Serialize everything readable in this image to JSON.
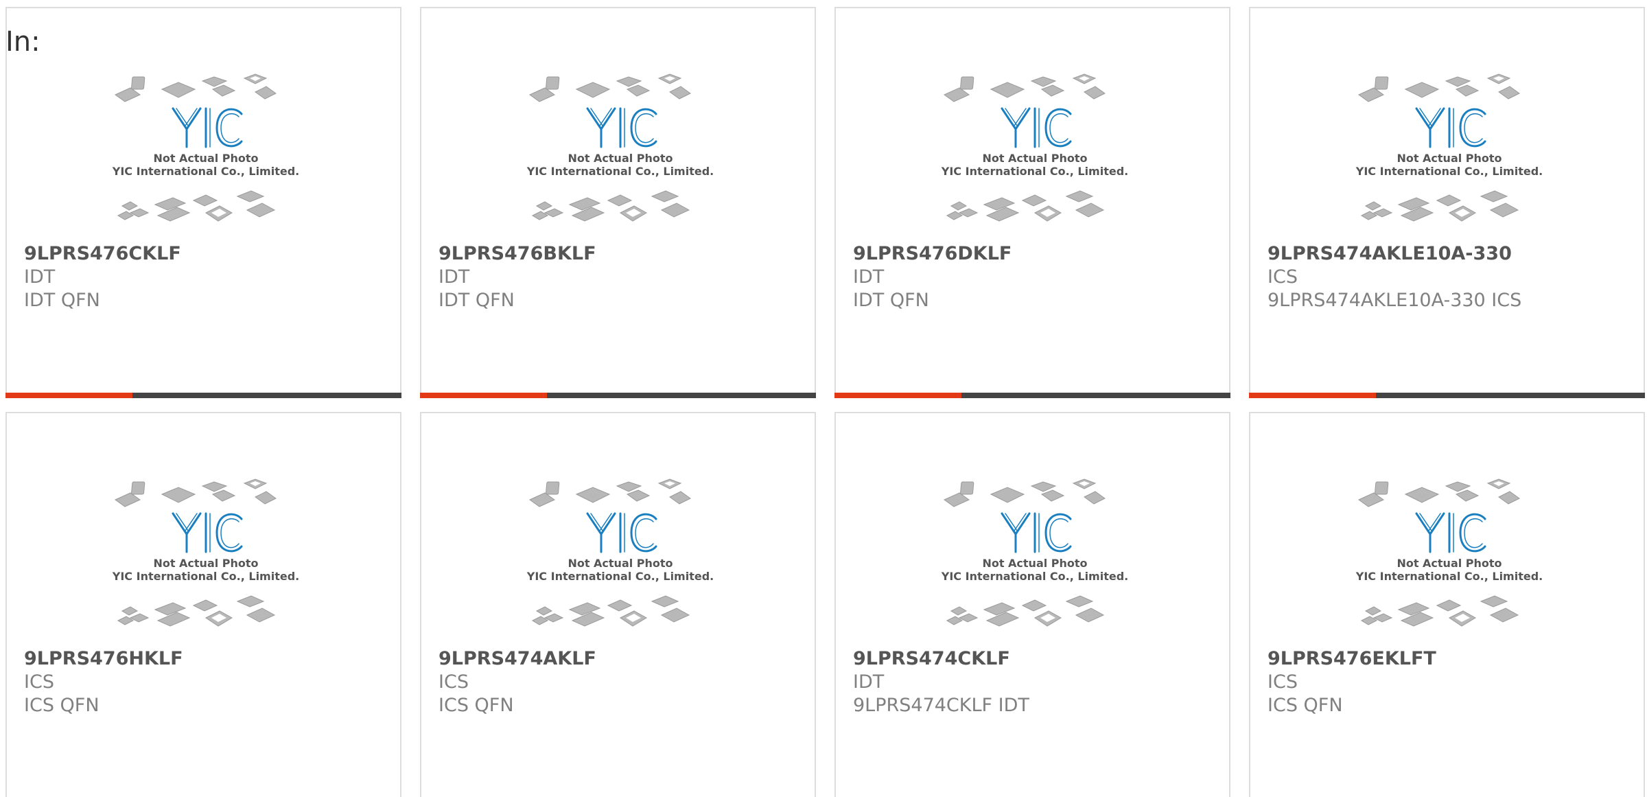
{
  "header": {
    "in_label": "In:"
  },
  "theme": {
    "accent": "#e23a16",
    "bar": "#444444",
    "logo_blue": "#1a7fc0"
  },
  "placeholder_image": {
    "icon": "yic-placeholder-photo",
    "caption_line1": "Not Actual Photo",
    "caption_line2": "YIC International Co., Limited.",
    "logo_text": "YIC"
  },
  "products": [
    {
      "part_number": "9LPRS476CKLF",
      "manufacturer": "IDT",
      "description": "IDT QFN"
    },
    {
      "part_number": "9LPRS476BKLF",
      "manufacturer": "IDT",
      "description": "IDT QFN"
    },
    {
      "part_number": "9LPRS476DKLF",
      "manufacturer": "IDT",
      "description": "IDT QFN"
    },
    {
      "part_number": "9LPRS474AKLE10A-330",
      "manufacturer": "ICS",
      "description": "9LPRS474AKLE10A-330 ICS"
    },
    {
      "part_number": "9LPRS476HKLF",
      "manufacturer": "ICS",
      "description": "ICS QFN"
    },
    {
      "part_number": "9LPRS474AKLF",
      "manufacturer": "ICS",
      "description": "ICS QFN"
    },
    {
      "part_number": "9LPRS474CKLF",
      "manufacturer": "IDT",
      "description": "9LPRS474CKLF IDT"
    },
    {
      "part_number": "9LPRS476EKLFT",
      "manufacturer": "ICS",
      "description": "ICS QFN"
    }
  ]
}
